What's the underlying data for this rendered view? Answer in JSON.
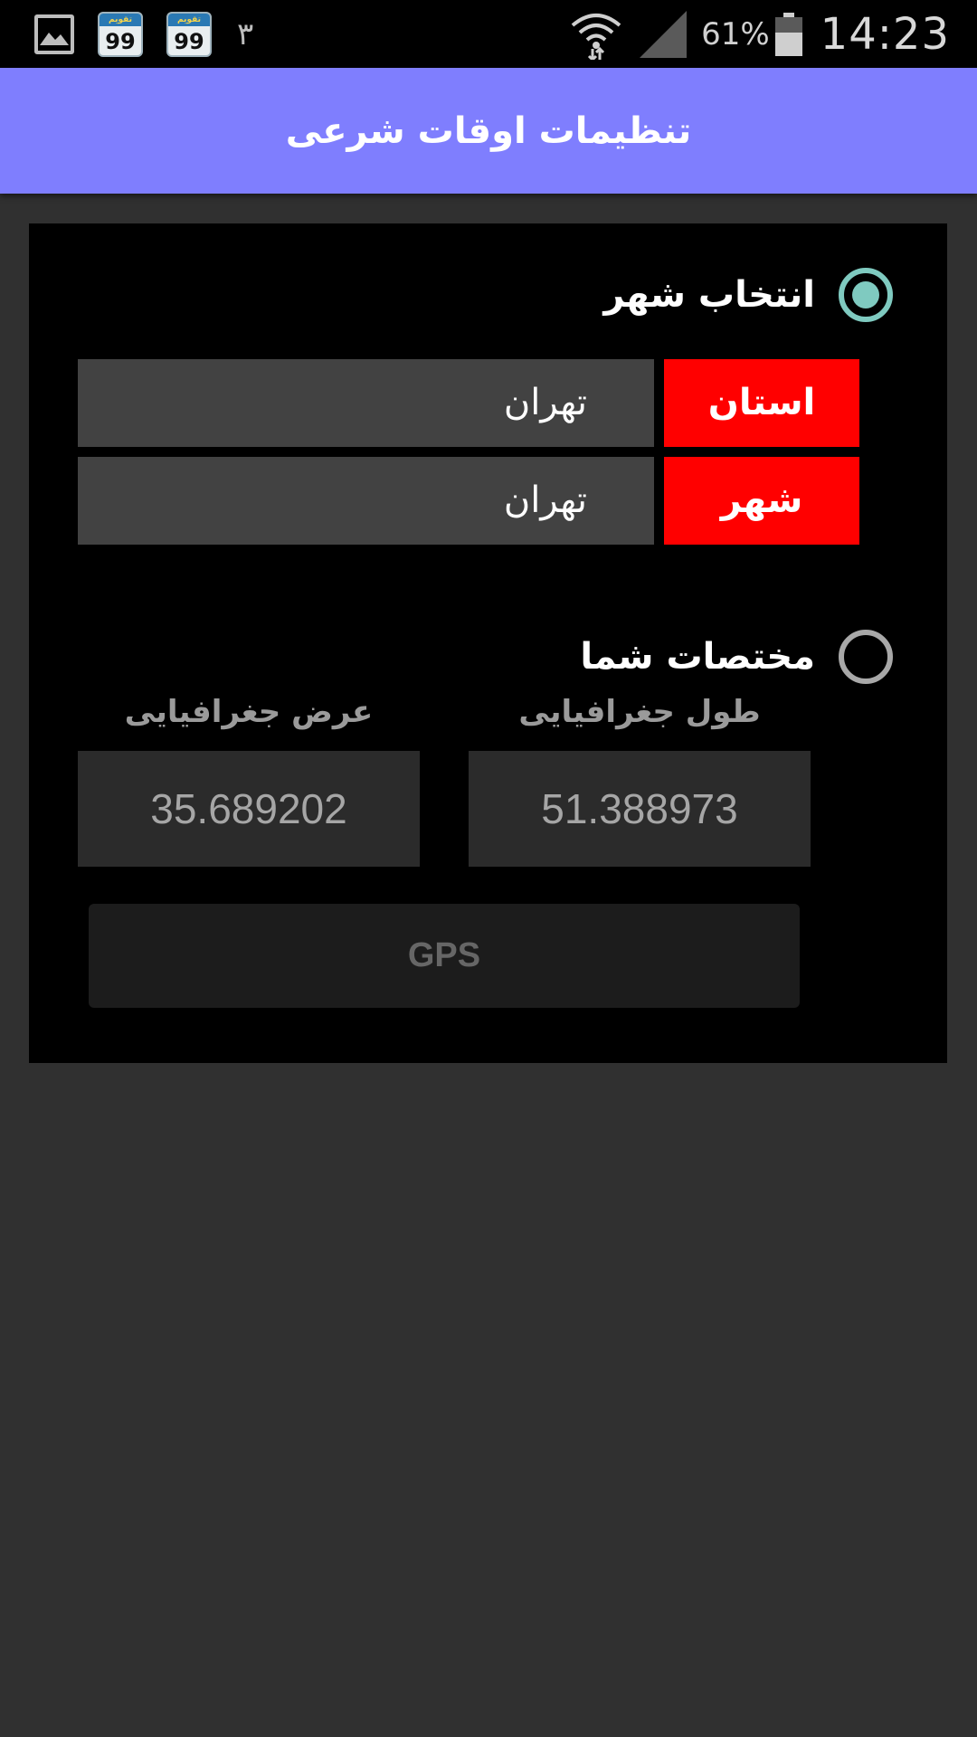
{
  "status_bar": {
    "notification_icons": [
      "gallery-icon",
      "calendar-99-app-icon",
      "calendar-99-app-icon"
    ],
    "app_icon_text": "تقویم",
    "app_icon_number": "99",
    "notification_count": "۳",
    "battery_percent": "61%",
    "time": "14:23"
  },
  "action_bar": {
    "title": "تنظیمات اوقات شرعی"
  },
  "city_section": {
    "radio_label": "انتخاب شهر",
    "selected": true,
    "province_label": "استان",
    "province_value": "تهران",
    "city_label": "شهر",
    "city_value": "تهران"
  },
  "coords_section": {
    "radio_label": "مختصات شما",
    "selected": false,
    "longitude_label": "طول جغرافیایی",
    "longitude_value": "51.388973",
    "latitude_label": "عرض جغرافیایی",
    "latitude_value": "35.689202"
  },
  "gps_button": {
    "label": "GPS",
    "enabled": false
  },
  "colors": {
    "action_bar": "#7f7efe",
    "label_red": "#ff0000",
    "radio_accent": "#7fcac0",
    "background": "#303030",
    "card": "#000000"
  }
}
